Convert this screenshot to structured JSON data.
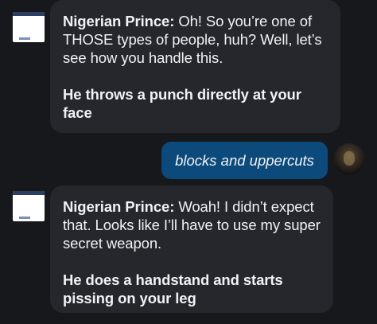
{
  "messages": [
    {
      "sender": "bot",
      "speaker": "Nigerian Prince:",
      "text": " Oh! So you’re one of THOSE types of people, huh? Well, let’s see how you handle this.",
      "action": "He throws a punch directly at your face"
    },
    {
      "sender": "user",
      "text": "blocks and uppercuts"
    },
    {
      "sender": "bot",
      "speaker": "Nigerian Prince:",
      "text": " Woah! I didn’t expect that. Looks like I’ll have to use my super secret weapon.",
      "action": "He does a handstand and starts pissing on your leg"
    }
  ],
  "colors": {
    "background": "#16181c",
    "bot_bubble": "#25272c",
    "user_bubble": "#0b4a7a",
    "text": "#f1f2f5"
  },
  "icons": {
    "bot_avatar": "bot-avatar-icon",
    "user_avatar": "user-avatar-icon"
  }
}
